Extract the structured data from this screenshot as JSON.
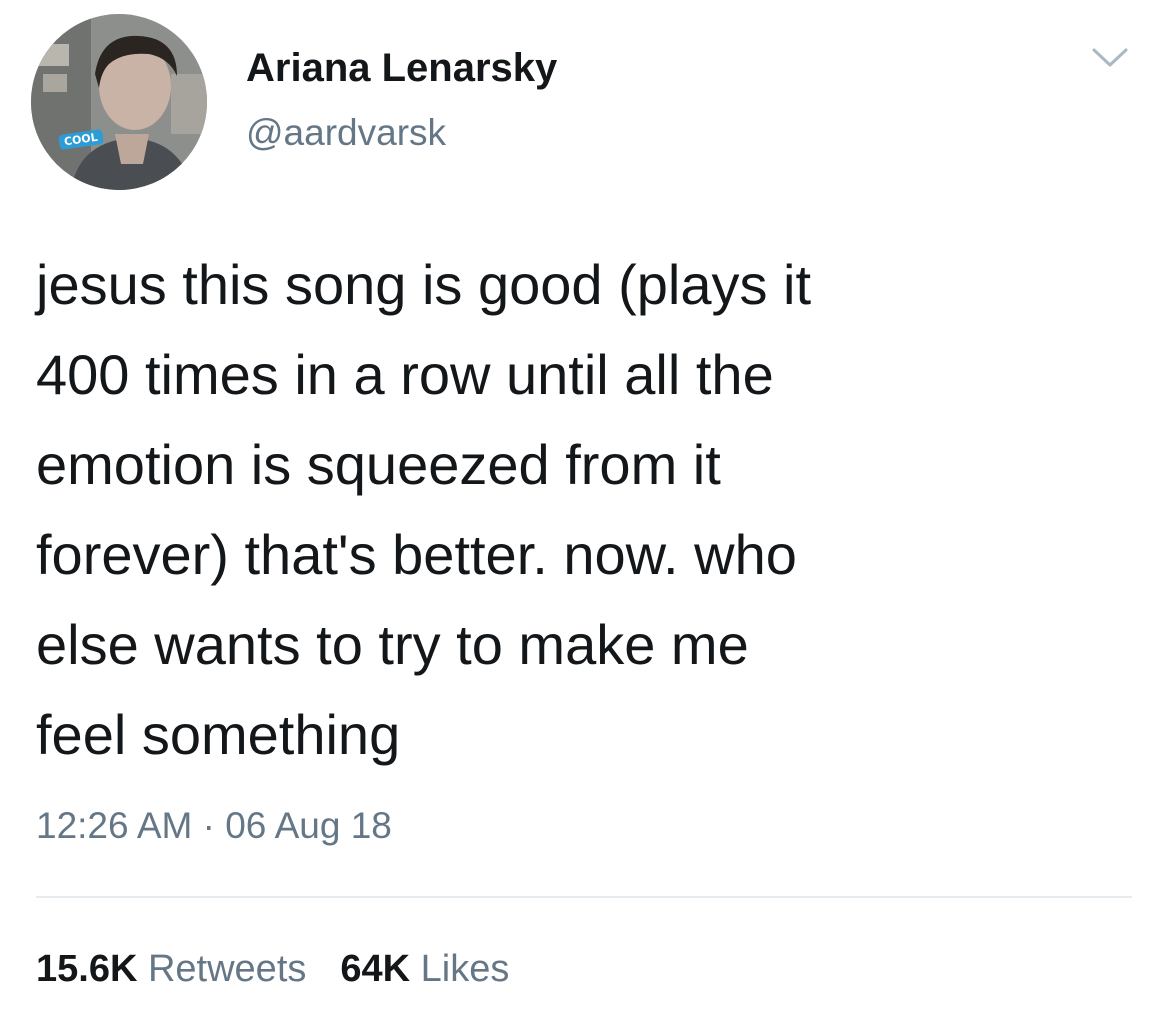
{
  "author": {
    "display_name": "Ariana Lenarsky",
    "handle": "@aardvarsk",
    "avatar_badge": "COOL"
  },
  "tweet": {
    "lines": [
      "jesus this song is good (plays it",
      "400 times in a row until all the",
      "emotion is squeezed from it",
      "forever) that's better. now. who",
      "else wants to try to make me",
      "feel something"
    ],
    "timestamp": "12:26 AM · 06 Aug 18"
  },
  "stats": {
    "retweets_count": "15.6K",
    "retweets_label": "Retweets",
    "likes_count": "64K",
    "likes_label": "Likes"
  },
  "icons": {
    "menu": "chevron-down-icon"
  },
  "colors": {
    "text": "#14171a",
    "secondary": "#657786",
    "divider": "#e6ecf0"
  }
}
